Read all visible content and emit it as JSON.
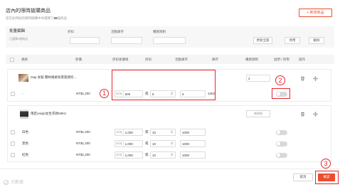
{
  "page": {
    "title": "店內的限時搶購商品",
    "subtitle_prefix": "您在此時段的限時搶購中共選擇了",
    "subtitle_count": "20",
    "subtitle_suffix": "個商品",
    "add_button": "+ 新增商品"
  },
  "batch": {
    "title": "批量編輯",
    "selected": "已選擇0個商品",
    "fields": [
      "折扣",
      "活動庫存",
      "購買限制"
    ],
    "buttons": [
      "更新全部",
      "停用",
      "刪除"
    ]
  },
  "table": {
    "headers": [
      "規格",
      "原價",
      "折扣後價格",
      "折扣",
      "活動庫存",
      "庫存",
      "購買限制",
      "啟用 / 停用",
      "操作"
    ],
    "currency_prefix": "NT$",
    "or_label": "或",
    "discount_unit": "折"
  },
  "products": [
    {
      "name": "Gap 女裝 簡約風格背景質感托...",
      "purchase_limit": "2",
      "variants": [
        {
          "name": "-",
          "price": "NT$1,200",
          "sale_price": "500",
          "discount": "5",
          "campaign_stock": "5",
          "stock": "1202",
          "enabled": false
        }
      ]
    },
    {
      "name": "限定uniqlo女生衣款MIKU",
      "purchase_limit": "無限制",
      "variants": [
        {
          "name": "白色",
          "price": "NT$1,200",
          "sale_price": "1,000",
          "discount": "10",
          "campaign_stock": "1000",
          "enabled": false
        },
        {
          "name": "黑色",
          "price": "NT$1,200",
          "sale_price": "1,000",
          "discount": "10",
          "campaign_stock": "1000",
          "enabled": false
        },
        {
          "name": "紅色",
          "price": "NT$1,200",
          "sale_price": "1,000",
          "discount": "10",
          "campaign_stock": "1000",
          "enabled": false
        }
      ]
    }
  ],
  "footer": {
    "cancel": "取消",
    "confirm": "確認"
  },
  "annotations": [
    "1",
    "2",
    "3"
  ],
  "watermark": "大數據",
  "icons": {
    "delete": "trash-icon",
    "reorder": "drag-handle-icon",
    "watermark_logo": "spiral-logo-icon"
  },
  "colors": {
    "accent": "#ee4d2d",
    "annotation": "#e3262e",
    "toggle_off": "#d9d9d9"
  }
}
